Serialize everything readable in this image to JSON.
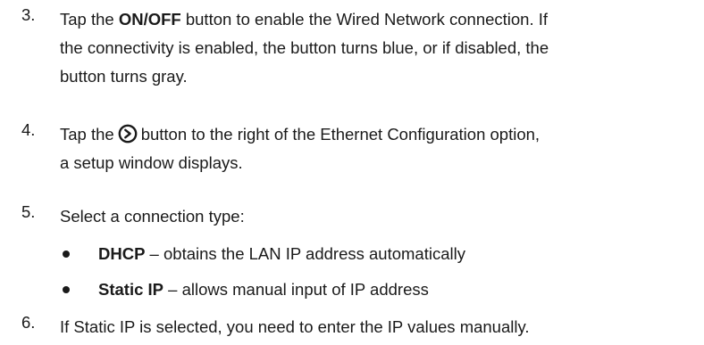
{
  "steps": [
    {
      "number": "3.",
      "lines": [
        {
          "pre": "Tap the ",
          "bold": "ON/OFF",
          "post": " button to enable the Wired Network connection. If"
        },
        {
          "text": "the connectivity is enabled, the button turns blue, or if disabled, the"
        },
        {
          "text": "button turns gray."
        }
      ]
    },
    {
      "number": "4.",
      "line1_pre": "Tap the",
      "icon": "circle-chevron-right-icon",
      "line1_post": "button to the right of the Ethernet Configuration option,",
      "line2": "a setup window displays."
    },
    {
      "number": "5.",
      "text": "Select a connection type:"
    },
    {
      "number": "6.",
      "text": "If Static IP is selected, you need to enter the IP values manually."
    }
  ],
  "bullets": [
    {
      "term": "DHCP",
      "desc": " – obtains the LAN IP address automatically"
    },
    {
      "term": "Static IP",
      "desc": " – allows manual input of IP address"
    }
  ]
}
